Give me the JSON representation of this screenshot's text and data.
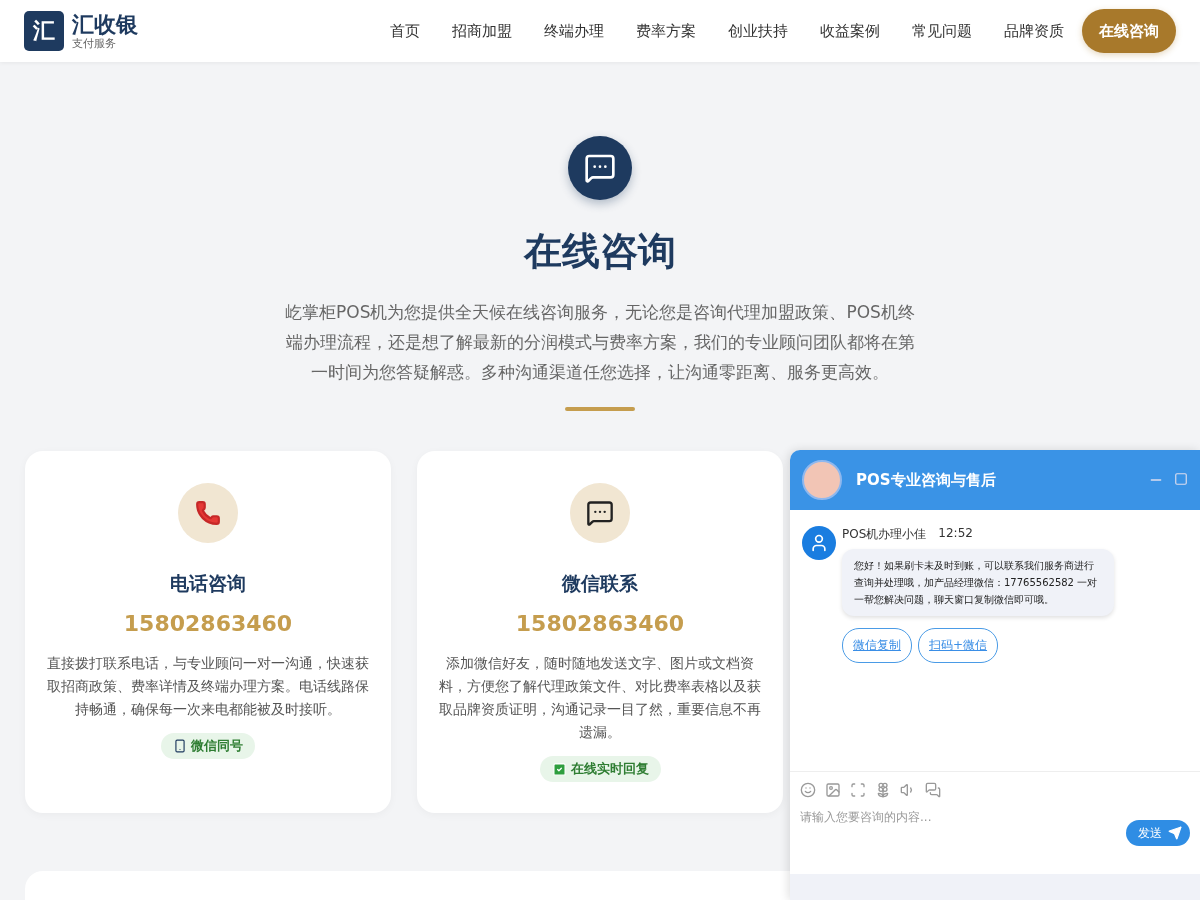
{
  "brand": {
    "mark": "汇",
    "name": "汇收银",
    "tagline": "支付服务"
  },
  "nav": {
    "items": [
      {
        "label": "首页"
      },
      {
        "label": "招商加盟"
      },
      {
        "label": "终端办理"
      },
      {
        "label": "费率方案"
      },
      {
        "label": "创业扶持"
      },
      {
        "label": "收益案例"
      },
      {
        "label": "常见问题"
      },
      {
        "label": "品牌资质"
      }
    ],
    "cta": "在线咨询"
  },
  "hero": {
    "title": "在线咨询",
    "description": "屹掌柜POS机为您提供全天候在线咨询服务，无论您是咨询代理加盟政策、POS机终端办理流程，还是想了解最新的分润模式与费率方案，我们的专业顾问团队都将在第一时间为您答疑解惑。多种沟通渠道任您选择，让沟通零距离、服务更高效。"
  },
  "cards": [
    {
      "kind": "phone",
      "title": "电话咨询",
      "number": "15802863460",
      "description": "直接拨打联系电话，与专业顾问一对一沟通，快速获取招商政策、费率详情及终端办理方案。电话线路保持畅通，确保每一次来电都能被及时接听。",
      "badge": {
        "kind": "mobile",
        "label": "微信同号"
      }
    },
    {
      "kind": "wechat",
      "title": "微信联系",
      "number": "15802863460",
      "description": "添加微信好友，随时随地发送文字、图片或文档资料，方便您了解代理政策文件、对比费率表格以及获取品牌资质证明，沟通记录一目了然，重要信息不再遗漏。",
      "badge": {
        "kind": "check",
        "label": "在线实时回复"
      }
    }
  ],
  "chat": {
    "title": "POS专业咨询与售后",
    "sender": "POS机办理小佳",
    "time": "12:52",
    "message": "您好！如果刷卡未及时到账，可以联系我们服务商进行查询并处理哦，加产品经理微信：17765562582 一对一帮您解决问题，聊天窗口复制微信即可哦。",
    "actions": [
      {
        "label": "微信复制"
      },
      {
        "label": "扫码+微信"
      }
    ],
    "input": {
      "placeholder": "请输入您要咨询的内容..."
    },
    "send": "发送"
  }
}
